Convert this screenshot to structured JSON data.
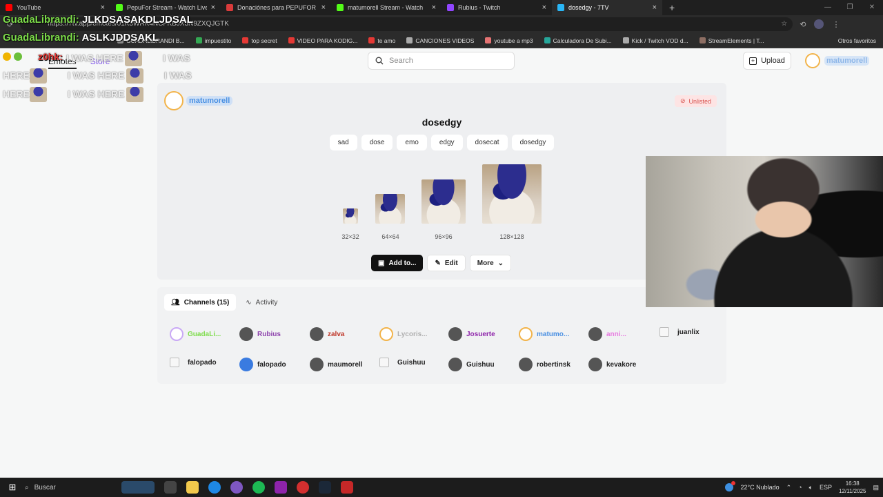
{
  "browser": {
    "tabs": [
      {
        "title": "YouTube",
        "color": "#ff0000",
        "active": false
      },
      {
        "title": "PepuFor Stream - Watch Live",
        "color": "#53fc18",
        "active": false
      },
      {
        "title": "Donaciónes para PEPUFOR | Cene",
        "color": "#d93b3b",
        "active": false
      },
      {
        "title": "matumorell Stream - Watch",
        "color": "#53fc18",
        "active": false
      },
      {
        "title": "Rubius - Twitch",
        "color": "#9146ff",
        "active": false
      },
      {
        "title": "dosedgy - 7TV",
        "color": "#29b6f6",
        "active": true
      }
    ],
    "url": "https://7tv.app/emotes/01K3WRK4NCFKBJX3N9ZXQJGTK",
    "bookmarks": [
      {
        "label": "GUADALIBRANDI B...",
        "color": "#888"
      },
      {
        "label": "impuestito",
        "color": "#34a853"
      },
      {
        "label": "top secret",
        "color": "#e53935"
      },
      {
        "label": "VIDEO PARA KODIG...",
        "color": "#e53935"
      },
      {
        "label": "te amo",
        "color": "#e53935"
      },
      {
        "label": "CANCIONES VIDEOS",
        "color": "#aaa"
      },
      {
        "label": "youtube a mp3",
        "color": "#e57373"
      },
      {
        "label": "Calculadora De Subi...",
        "color": "#26a69a"
      },
      {
        "label": "Kick / Twitch VOD d...",
        "color": "#aaa"
      },
      {
        "label": "StreamElements | T...",
        "color": "#8d6e63"
      }
    ],
    "bookmarks_other": "Otros favoritos"
  },
  "overlay": {
    "line1_user": "GuadaLibrandi:",
    "line1_msg": "JLKDSASAKDLJDSAL",
    "line2_user": "GuadaLibrandi:",
    "line2_msg": "ASLKJDDSAKL",
    "line3_user": "z0hk:",
    "was_here_1": "I WAS HERE",
    "was_here_2": "I WAS",
    "here_word": "HERE"
  },
  "site": {
    "nav_emotes": "Emotes",
    "nav_store": "Store",
    "search_placeholder": "Search",
    "upload_label": "Upload",
    "user_name": "matumorell"
  },
  "emote": {
    "owner": "matumorell",
    "visibility": "Unlisted",
    "name": "dosedgy",
    "tags": [
      "sad",
      "dose",
      "emo",
      "edgy",
      "dosecat",
      "dosedgy"
    ],
    "sizes": [
      "32×32",
      "64×64",
      "96×96",
      "128×128"
    ],
    "actions": {
      "add": "Add to...",
      "edit": "Edit",
      "more": "More"
    }
  },
  "channels": {
    "tab_channels": "Channels (15)",
    "tab_activity": "Activity",
    "items": [
      {
        "name": "GuadaLi...",
        "color": "#7ddc4a",
        "avatar": "ring"
      },
      {
        "name": "Rubius",
        "color": "#8e44ad",
        "avatar": "photo"
      },
      {
        "name": "zalva",
        "color": "#c0392b",
        "avatar": "photo"
      },
      {
        "name": "Lycoris...",
        "color": "#b0b0b0",
        "avatar": "ringy"
      },
      {
        "name": "Josuerte",
        "color": "#8e24aa",
        "avatar": "photo"
      },
      {
        "name": "matumo...",
        "color": "#4a90e2",
        "avatar": "ringy"
      },
      {
        "name": "anni...",
        "color": "#e77be0",
        "avatar": "photo"
      },
      {
        "name": "juanlix",
        "color": "#222222",
        "avatar": "broken"
      },
      {
        "name": "falopado",
        "color": "#222222",
        "avatar": "broken"
      },
      {
        "name": "falopado",
        "color": "#222222",
        "avatar": "blue"
      },
      {
        "name": "maumorell",
        "color": "#222222",
        "avatar": "photo"
      },
      {
        "name": "Guishuu",
        "color": "#222222",
        "avatar": "broken"
      },
      {
        "name": "Guishuu",
        "color": "#222222",
        "avatar": "photo"
      },
      {
        "name": "robertinsk",
        "color": "#222222",
        "avatar": "photo"
      },
      {
        "name": "kevakore",
        "color": "#222222",
        "avatar": "photo"
      }
    ]
  },
  "taskbar": {
    "search": "Buscar",
    "weather": "22°C  Nublado",
    "lang": "ESP",
    "time": "16:38",
    "date": "12/11/2025"
  }
}
